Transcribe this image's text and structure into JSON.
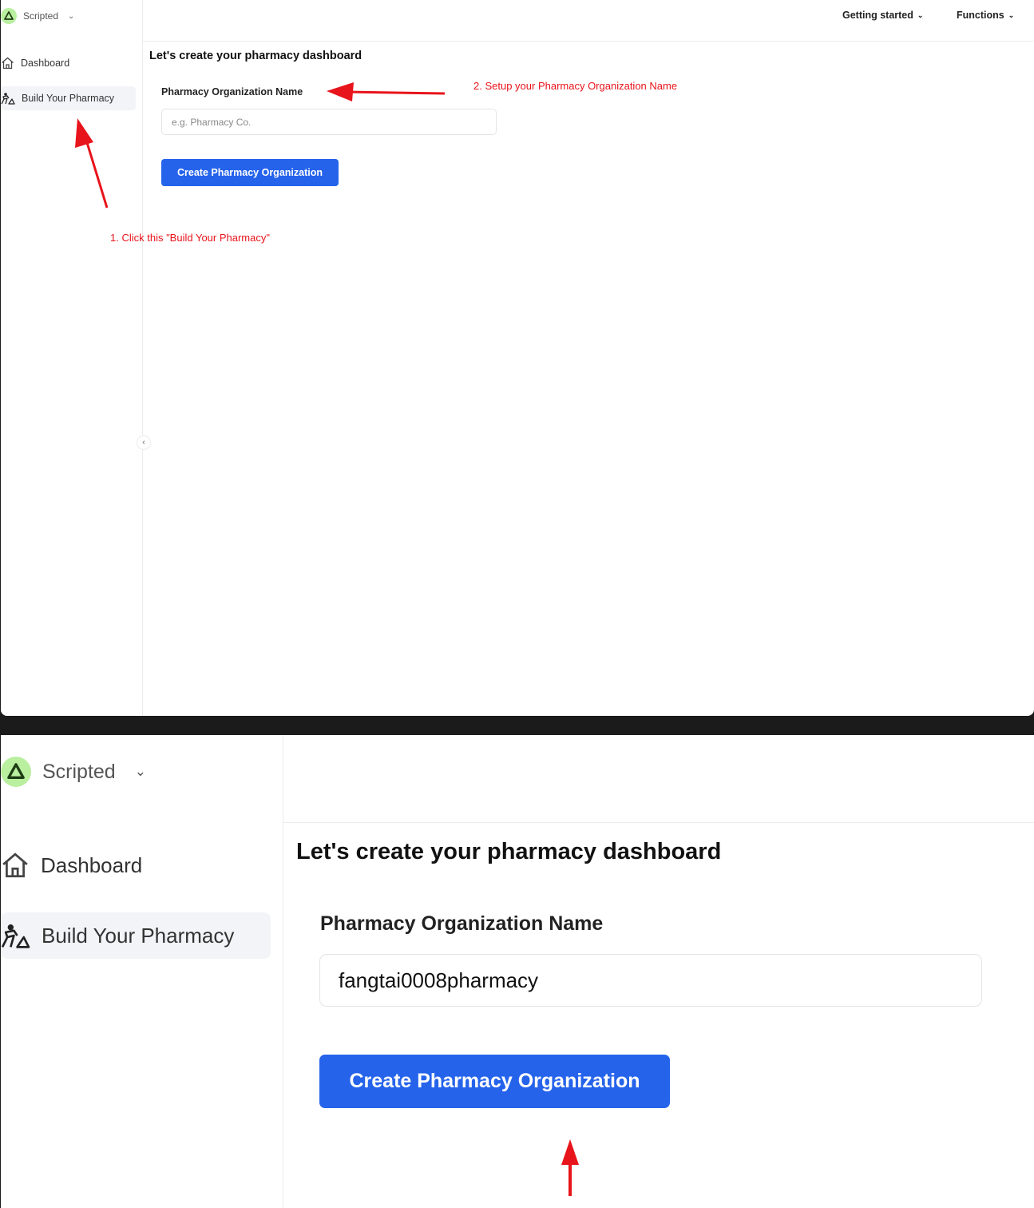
{
  "app": {
    "name": "Scripted"
  },
  "sidebar": {
    "items": [
      {
        "label": "Dashboard",
        "icon": "home-icon"
      },
      {
        "label": "Build Your Pharmacy",
        "icon": "builder-icon"
      }
    ]
  },
  "topnav": {
    "items": [
      {
        "label": "Getting started"
      },
      {
        "label": "Functions"
      }
    ]
  },
  "main": {
    "title": "Let's create your pharmacy dashboard",
    "field_label": "Pharmacy Organization Name",
    "placeholder": "e.g. Pharmacy Co.",
    "button_label": "Create Pharmacy Organization"
  },
  "annotations": {
    "step1": "1. Click this \"Build Your Pharmacy\"",
    "step2": "2. Setup your Pharmacy Organization Name",
    "color": "#e8141b"
  },
  "filled": {
    "input_value": "fangtai0008pharmacy"
  },
  "colors": {
    "accent": "#2563eb",
    "logo_bg": "#b9ef9f",
    "active_nav_bg": "#f2f4f7"
  }
}
